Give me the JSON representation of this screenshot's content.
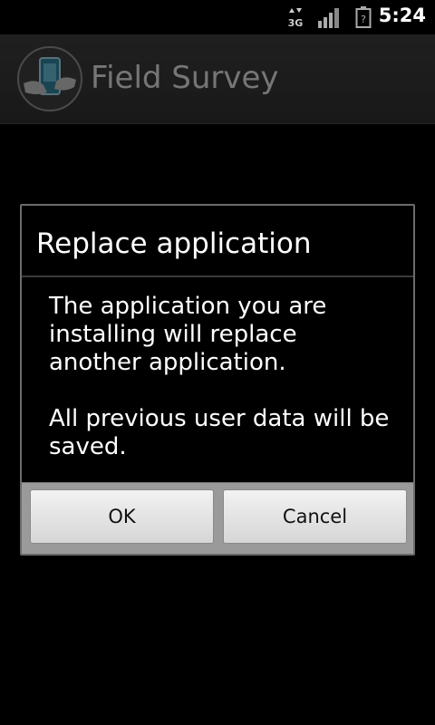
{
  "status_bar": {
    "network_icon": "3g-data-icon",
    "network_label": "3G",
    "signal_icon": "signal-strength-icon",
    "battery_icon": "battery-unknown-icon",
    "time": "5:24"
  },
  "app_bar": {
    "logo_icon": "field-survey-logo",
    "title": "Field Survey"
  },
  "dialog": {
    "title": "Replace application",
    "message_line1": "The application you are installing will replace another application.",
    "message_line2": "All previous user data will be saved.",
    "ok_label": "OK",
    "cancel_label": "Cancel"
  }
}
